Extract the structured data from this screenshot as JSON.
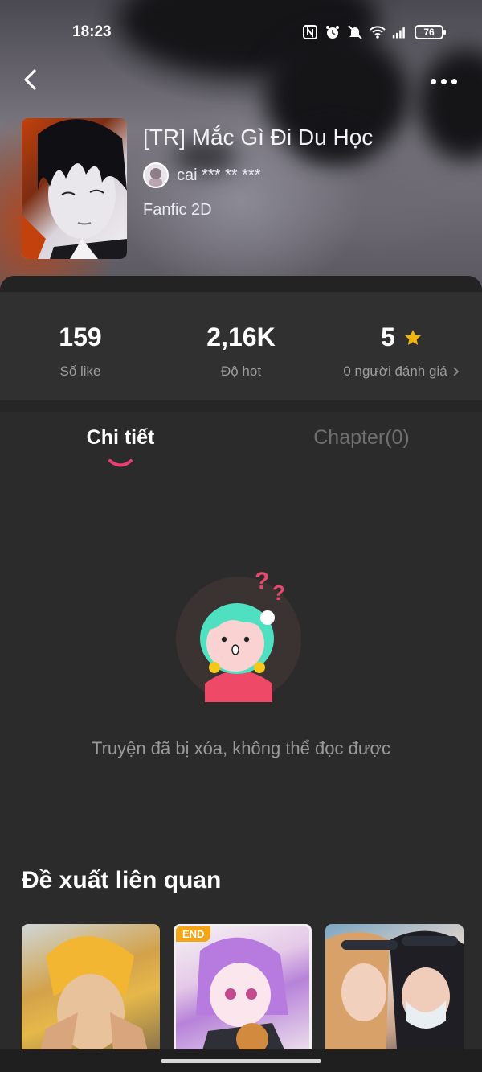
{
  "status_bar": {
    "time": "18:23",
    "battery": "76",
    "icons": [
      "nfc-icon",
      "alarm-icon",
      "mute-icon",
      "wifi-icon",
      "signal-icon",
      "battery-icon"
    ]
  },
  "nav": {
    "back_icon": "chevron-left-icon",
    "more_icon": "more-dots-icon"
  },
  "story": {
    "title": "[TR] Mắc Gì Đi Du Học",
    "author": "cai *** ** ***",
    "genre": "Fanfic 2D"
  },
  "stats": [
    {
      "value": "159",
      "label": "Số like"
    },
    {
      "value": "2,16K",
      "label": "Độ hot"
    },
    {
      "value": "5",
      "label": "0 người đánh giá",
      "icon": "star-icon",
      "star_color": "#f5b40b"
    }
  ],
  "tabs": {
    "active": "Chi tiết",
    "inactive": "Chapter(0)",
    "underline_color": "#ea3f70"
  },
  "empty_state": {
    "message": "Truyện đã bị xóa, không thể đọc được"
  },
  "related": {
    "title": "Đề xuất liên quan",
    "items": [
      {
        "badge": ""
      },
      {
        "badge": "END"
      },
      {
        "badge": ""
      }
    ]
  }
}
